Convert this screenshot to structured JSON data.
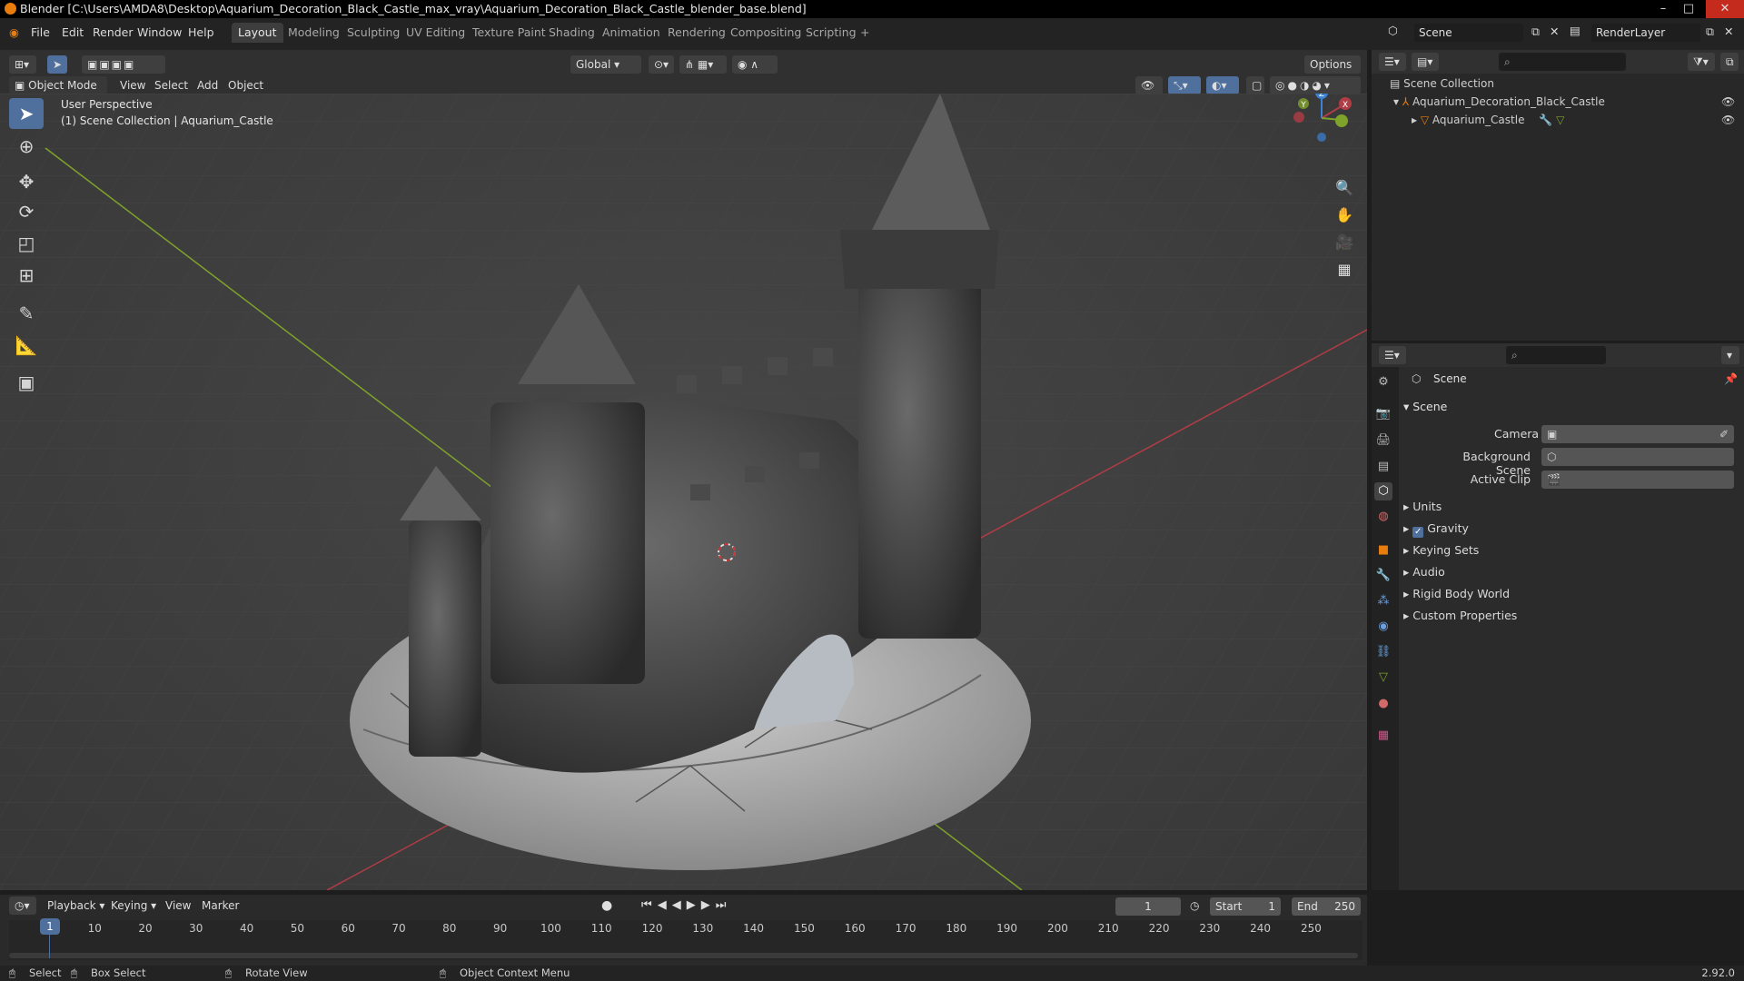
{
  "window": {
    "title": "Blender [C:\\Users\\AMDA8\\Desktop\\Aquarium_Decoration_Black_Castle_max_vray\\Aquarium_Decoration_Black_Castle_blender_base.blend]"
  },
  "menu": {
    "items": [
      "File",
      "Edit",
      "Render",
      "Window",
      "Help"
    ]
  },
  "workspaces": [
    "Layout",
    "Modeling",
    "Sculpting",
    "UV Editing",
    "Texture Paint",
    "Shading",
    "Animation",
    "Rendering",
    "Compositing",
    "Scripting",
    "+"
  ],
  "topbar": {
    "scene": "Scene",
    "render_layer": "RenderLayer"
  },
  "viewport_header": {
    "mode": "Object Mode",
    "menus": [
      "View",
      "Select",
      "Add",
      "Object"
    ],
    "orientation": "Global",
    "options": "Options"
  },
  "viewport": {
    "perspective": "User Perspective",
    "collection_info": "(1) Scene Collection | Aquarium_Castle",
    "gizmo": {
      "x": "X",
      "y": "Y",
      "z": "Z"
    }
  },
  "outliner": {
    "root": "Scene Collection",
    "items": [
      {
        "label": "Aquarium_Decoration_Black_Castle"
      },
      {
        "label": "Aquarium_Castle"
      }
    ]
  },
  "properties": {
    "header": "Scene",
    "panel": "Scene",
    "camera_label": "Camera",
    "bg_scene_label": "Background Scene",
    "active_clip_label": "Active Clip",
    "sections": [
      "Units",
      "Gravity",
      "Keying Sets",
      "Audio",
      "Rigid Body World",
      "Custom Properties"
    ]
  },
  "timeline": {
    "menus": [
      "Playback",
      "Keying",
      "View",
      "Marker"
    ],
    "current_frame": "1",
    "start_label": "Start",
    "start": "1",
    "end_label": "End",
    "end": "250",
    "current_marker": "1",
    "ticks": [
      "10",
      "20",
      "30",
      "40",
      "50",
      "60",
      "70",
      "80",
      "90",
      "100",
      "110",
      "120",
      "130",
      "140",
      "150",
      "160",
      "170",
      "180",
      "190",
      "200",
      "210",
      "220",
      "230",
      "240",
      "250"
    ]
  },
  "statusbar": {
    "select": "Select",
    "box_select": "Box Select",
    "rotate_view": "Rotate View",
    "context_menu": "Object Context Menu",
    "version": "2.92.0"
  },
  "colors": {
    "accent": "#4f6f9d",
    "x_axis": "#b03c46",
    "y_axis": "#7fa22b",
    "z_axis": "#3b82d6",
    "orange": "#e87d0d"
  }
}
